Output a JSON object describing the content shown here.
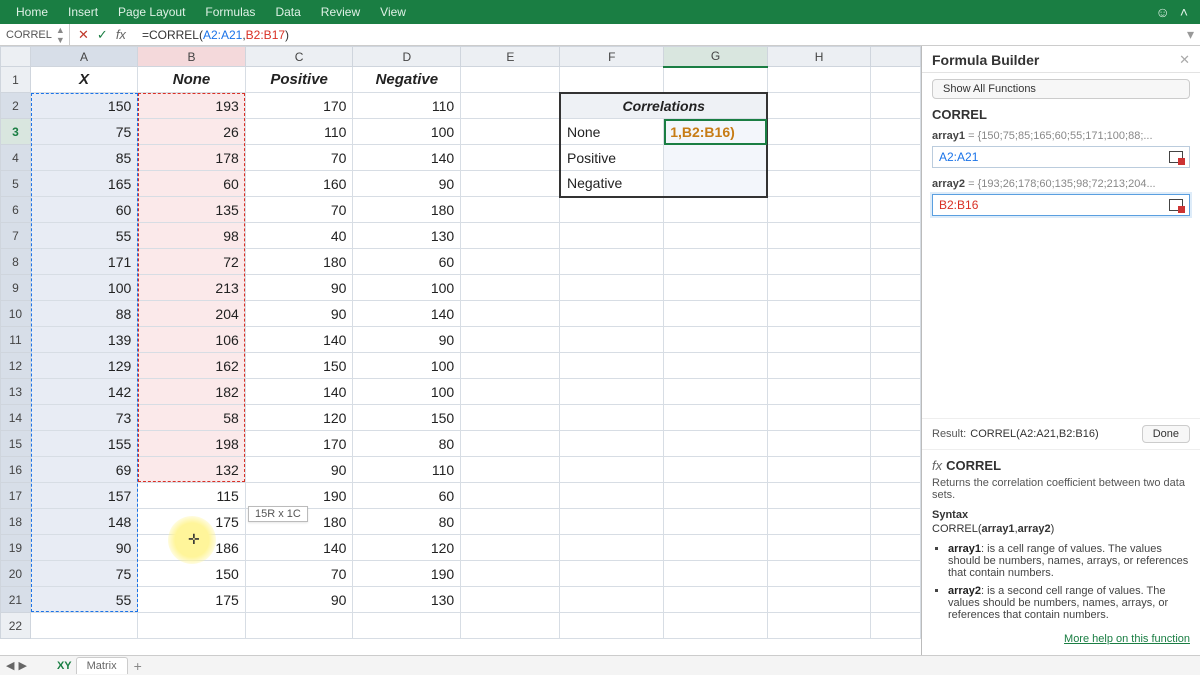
{
  "ribbon": {
    "tabs": [
      "Home",
      "Insert",
      "Page Layout",
      "Formulas",
      "Data",
      "Review",
      "View"
    ]
  },
  "namebox": "CORREL",
  "formula": {
    "prefix": "=CORREL(",
    "ref1": "A2:A21",
    "sep": ",",
    "ref2": "B2:B17",
    "suffix": ")"
  },
  "columns": [
    "A",
    "B",
    "C",
    "D",
    "E",
    "F",
    "G",
    "H"
  ],
  "headers": {
    "A": "X",
    "B": "None",
    "C": "Positive",
    "D": "Negative"
  },
  "rows": [
    {
      "A": 150,
      "B": 193,
      "C": 170,
      "D": 110
    },
    {
      "A": 75,
      "B": 26,
      "C": 110,
      "D": 100
    },
    {
      "A": 85,
      "B": 178,
      "C": 70,
      "D": 140
    },
    {
      "A": 165,
      "B": 60,
      "C": 160,
      "D": 90
    },
    {
      "A": 60,
      "B": 135,
      "C": 70,
      "D": 180
    },
    {
      "A": 55,
      "B": 98,
      "C": 40,
      "D": 130
    },
    {
      "A": 171,
      "B": 72,
      "C": 180,
      "D": 60
    },
    {
      "A": 100,
      "B": 213,
      "C": 90,
      "D": 100
    },
    {
      "A": 88,
      "B": 204,
      "C": 90,
      "D": 140
    },
    {
      "A": 139,
      "B": 106,
      "C": 140,
      "D": 90
    },
    {
      "A": 129,
      "B": 162,
      "C": 150,
      "D": 100
    },
    {
      "A": 142,
      "B": 182,
      "C": 140,
      "D": 100
    },
    {
      "A": 73,
      "B": 58,
      "C": 120,
      "D": 150
    },
    {
      "A": 155,
      "B": 198,
      "C": 170,
      "D": 80
    },
    {
      "A": 69,
      "B": 132,
      "C": 90,
      "D": 110
    },
    {
      "A": 157,
      "B": 115,
      "C": 190,
      "D": 60
    },
    {
      "A": 148,
      "B": 175,
      "C": 180,
      "D": 80
    },
    {
      "A": 90,
      "B": 186,
      "C": 140,
      "D": 120
    },
    {
      "A": 75,
      "B": 150,
      "C": 70,
      "D": 190
    },
    {
      "A": 55,
      "B": 175,
      "C": 90,
      "D": 130
    }
  ],
  "corr": {
    "title": "Correlations",
    "labels": [
      "None",
      "Positive",
      "Negative"
    ],
    "g3": "1,B2:B16)"
  },
  "sel_tooltip": "15R x 1C",
  "pane": {
    "title": "Formula Builder",
    "show_all": "Show All Functions",
    "fn": "CORREL",
    "arg1_label": "array1",
    "arg1_vals": "{150;75;85;165;60;55;171;100;88;...",
    "arg1_input": "A2:A21",
    "arg2_label": "array2",
    "arg2_vals": "{193;26;178;60;135;98;72;213;204...",
    "arg2_input": "B2:B16",
    "result_label": "Result:",
    "result_val": "CORREL(A2:A21,B2:B16)",
    "done": "Done",
    "help_fn": "CORREL",
    "help_desc": "Returns the correlation coefficient between two data sets.",
    "syntax_label": "Syntax",
    "syntax_line": "CORREL(array1,array2)",
    "bullets": [
      {
        "b": "array1",
        "t": ": is a cell range of values. The values should be numbers, names, arrays, or references that contain numbers."
      },
      {
        "b": "array2",
        "t": ": is a second cell range of values. The values should be numbers, names, arrays, or references that contain numbers."
      }
    ],
    "more_help": "More help on this function"
  },
  "sheets": {
    "active": "XY",
    "other": "Matrix"
  }
}
